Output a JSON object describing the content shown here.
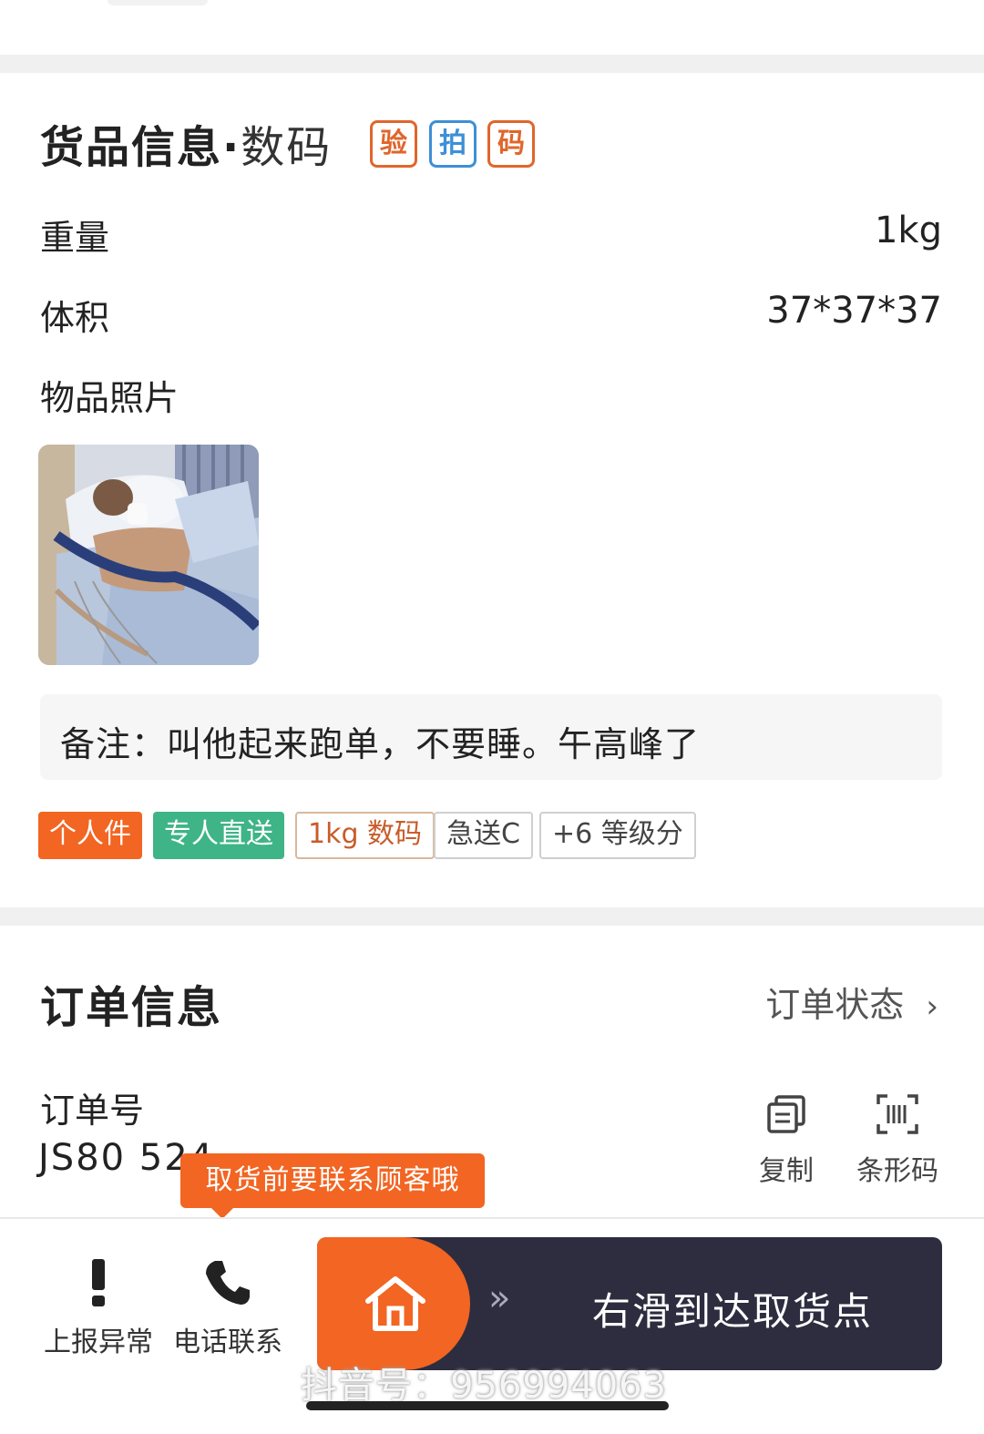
{
  "goods": {
    "title": "货品信息",
    "dot": "·",
    "category": "数码",
    "badges": [
      "验",
      "拍",
      "码"
    ],
    "weight_label": "重量",
    "weight_value": "1kg",
    "volume_label": "体积",
    "volume_value": "37*37*37",
    "photo_label": "物品照片",
    "note": "备注：叫他起来跑单，不要睡。午高峰了",
    "tags": [
      "个人件",
      "专人直送",
      "1kg 数码",
      "急送C",
      "+6 等级分"
    ]
  },
  "order": {
    "title": "订单信息",
    "status_link": "订单状态",
    "number_label": "订单号",
    "number_value": "JS80 524",
    "copy_label": "复制",
    "barcode_label": "条形码",
    "tooltip": "取货前要联系顾客哦"
  },
  "bottom_bar": {
    "report_label": "上报异常",
    "call_label": "电话联系",
    "slide_text": "右滑到达取货点",
    "chevrons": "»"
  },
  "watermark": "抖音号：956994063",
  "colors": {
    "accent_orange": "#f26522",
    "tag_green": "#3fb487",
    "slider_dark": "#2d2d3f",
    "badge_blue": "#3d8fd6"
  }
}
